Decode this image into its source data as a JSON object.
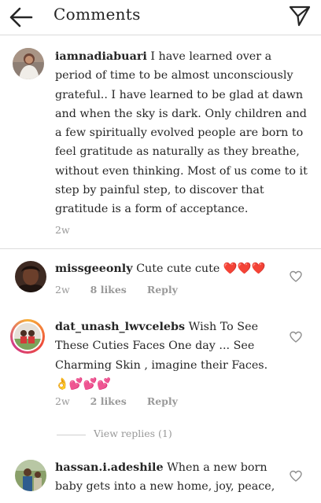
{
  "header": {
    "title": "Comments"
  },
  "caption": {
    "username": "iamnadiabuari",
    "text": "I have learned over a period of time to be almost unconsciously grateful.. I have learned to be glad at dawn and when the sky is dark. Only children and a few spiritually evolved people are born to feel gratitude as naturally as they breathe, without even thinking. Most of us come to it step by painful step, to discover that gratitude is a form of acceptance.",
    "time": "2w"
  },
  "comments": [
    {
      "username": "missgeeonly",
      "text": "Cute cute cute",
      "emoji": "❤️❤️❤️",
      "time": "2w",
      "likes": "8 likes",
      "reply": "Reply"
    },
    {
      "username": "dat_unash_lwvcelebs",
      "text": "Wish To See These Cuties Faces One day ... See Charming Skin , imagine their Faces.",
      "emoji": "👌💕💕💕",
      "time": "2w",
      "likes": "2 likes",
      "reply": "Reply",
      "view_replies": "View replies (1)"
    },
    {
      "username": "hassan.i.adeshile",
      "text": "When a new born baby gets into a new home, joy, peace,"
    }
  ],
  "icons": {
    "back": "arrow-left-icon",
    "send": "paper-plane-icon",
    "like": "heart-outline-icon"
  },
  "colors": {
    "heart": "#d91e2a",
    "text": "#262626",
    "muted": "#999999",
    "divider": "#dbdbdb"
  }
}
